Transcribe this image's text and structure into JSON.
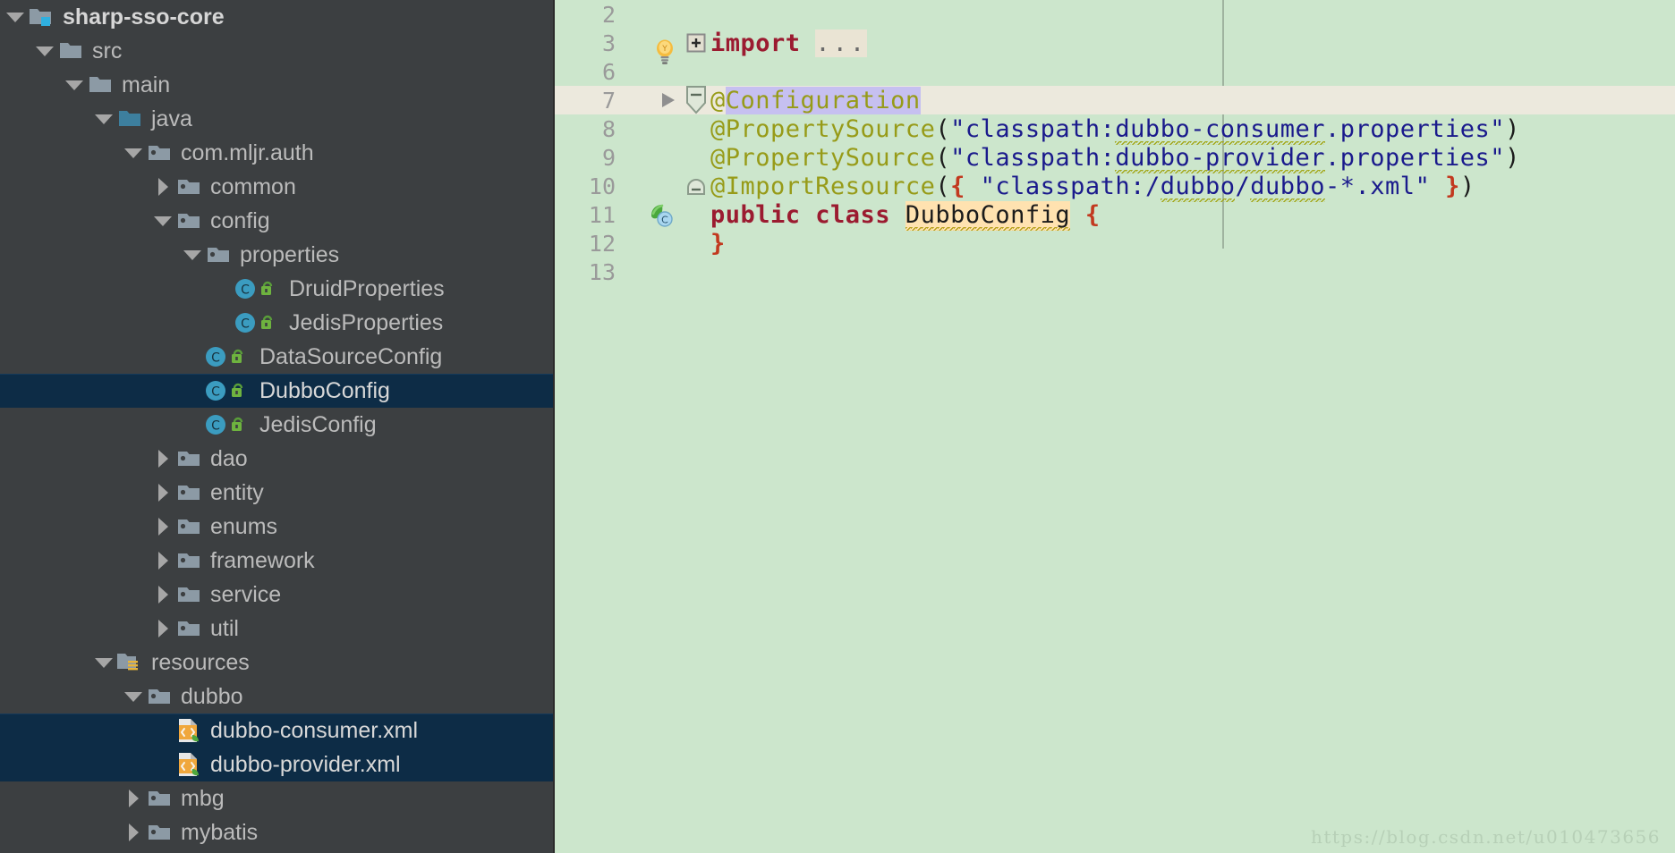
{
  "app": {
    "theme_sidebar_bg": "#3c3f41",
    "theme_editor_bg": "#cce6cc",
    "selection_bg": "#0d2c46",
    "caret_row_bg": "#ece9dd",
    "watermark": "https://blog.csdn.net/u010473656"
  },
  "project_tree": {
    "items": [
      {
        "label": "sharp-sso-core",
        "depth": 0,
        "twisty": "down",
        "icon": "module-folder-icon",
        "selected": false,
        "bold": true
      },
      {
        "label": "src",
        "depth": 1,
        "twisty": "down",
        "icon": "folder-icon",
        "selected": false,
        "bold": false
      },
      {
        "label": "main",
        "depth": 2,
        "twisty": "down",
        "icon": "folder-icon",
        "selected": false,
        "bold": false
      },
      {
        "label": "java",
        "depth": 3,
        "twisty": "down",
        "icon": "source-root-icon",
        "selected": false,
        "bold": false
      },
      {
        "label": "com.mljr.auth",
        "depth": 4,
        "twisty": "down",
        "icon": "package-icon",
        "selected": false,
        "bold": false
      },
      {
        "label": "common",
        "depth": 5,
        "twisty": "right",
        "icon": "package-icon",
        "selected": false,
        "bold": false
      },
      {
        "label": "config",
        "depth": 5,
        "twisty": "down",
        "icon": "package-icon",
        "selected": false,
        "bold": false
      },
      {
        "label": "properties",
        "depth": 6,
        "twisty": "down",
        "icon": "package-icon",
        "selected": false,
        "bold": false
      },
      {
        "label": "DruidProperties",
        "depth": 7,
        "twisty": "none",
        "icon": "java-class-icon",
        "selected": false,
        "bold": false
      },
      {
        "label": "JedisProperties",
        "depth": 7,
        "twisty": "none",
        "icon": "java-class-icon",
        "selected": false,
        "bold": false
      },
      {
        "label": "DataSourceConfig",
        "depth": 6,
        "twisty": "none",
        "icon": "java-class-icon",
        "selected": false,
        "bold": false
      },
      {
        "label": "DubboConfig",
        "depth": 6,
        "twisty": "none",
        "icon": "java-class-icon",
        "selected": true,
        "bold": false
      },
      {
        "label": "JedisConfig",
        "depth": 6,
        "twisty": "none",
        "icon": "java-class-icon",
        "selected": false,
        "bold": false
      },
      {
        "label": "dao",
        "depth": 5,
        "twisty": "right",
        "icon": "package-icon",
        "selected": false,
        "bold": false
      },
      {
        "label": "entity",
        "depth": 5,
        "twisty": "right",
        "icon": "package-icon",
        "selected": false,
        "bold": false
      },
      {
        "label": "enums",
        "depth": 5,
        "twisty": "right",
        "icon": "package-icon",
        "selected": false,
        "bold": false
      },
      {
        "label": "framework",
        "depth": 5,
        "twisty": "right",
        "icon": "package-icon",
        "selected": false,
        "bold": false
      },
      {
        "label": "service",
        "depth": 5,
        "twisty": "right",
        "icon": "package-icon",
        "selected": false,
        "bold": false
      },
      {
        "label": "util",
        "depth": 5,
        "twisty": "right",
        "icon": "package-icon",
        "selected": false,
        "bold": false
      },
      {
        "label": "resources",
        "depth": 3,
        "twisty": "down",
        "icon": "resources-root-icon",
        "selected": false,
        "bold": false
      },
      {
        "label": "dubbo",
        "depth": 4,
        "twisty": "down",
        "icon": "package-icon",
        "selected": false,
        "bold": false
      },
      {
        "label": "dubbo-consumer.xml",
        "depth": 5,
        "twisty": "none",
        "icon": "spring-xml-icon",
        "selected": true,
        "bold": false
      },
      {
        "label": "dubbo-provider.xml",
        "depth": 5,
        "twisty": "none",
        "icon": "spring-xml-icon",
        "selected": true,
        "bold": false
      },
      {
        "label": "mbg",
        "depth": 4,
        "twisty": "right",
        "icon": "package-icon",
        "selected": false,
        "bold": false
      },
      {
        "label": "mybatis",
        "depth": 4,
        "twisty": "right",
        "icon": "package-icon",
        "selected": false,
        "bold": false
      }
    ]
  },
  "editor": {
    "file": "DubboConfig",
    "lines": [
      {
        "num": "2",
        "caret": false,
        "fold": "",
        "gutter": "",
        "tokens": []
      },
      {
        "num": "3",
        "caret": false,
        "fold": "plus",
        "gutter": "",
        "tokens": [
          {
            "t": "import",
            "c": "tk-kw"
          },
          {
            "t": " ",
            "c": "tk-punct"
          },
          {
            "t": "...",
            "c": "tk-fold"
          }
        ]
      },
      {
        "num": "6",
        "caret": false,
        "fold": "",
        "gutter": "lightbulb-icon",
        "tokens": []
      },
      {
        "num": "7",
        "caret": true,
        "fold": "minus-shield",
        "gutter": "fold-arrow-icon",
        "tokens": [
          {
            "t": "@",
            "c": "tk-anno"
          },
          {
            "t": "Configuration",
            "c": "tk-sel"
          }
        ]
      },
      {
        "num": "8",
        "caret": false,
        "fold": "",
        "gutter": "",
        "tokens": [
          {
            "t": "@PropertySource",
            "c": "tk-anno"
          },
          {
            "t": "(",
            "c": "tk-punct"
          },
          {
            "t": "\"classpath:",
            "c": "tk-str"
          },
          {
            "t": "dubbo-consumer",
            "c": "tk-str squig"
          },
          {
            "t": ".properties\"",
            "c": "tk-str"
          },
          {
            "t": ")",
            "c": "tk-punct"
          }
        ]
      },
      {
        "num": "9",
        "caret": false,
        "fold": "",
        "gutter": "",
        "tokens": [
          {
            "t": "@PropertySource",
            "c": "tk-anno"
          },
          {
            "t": "(",
            "c": "tk-punct"
          },
          {
            "t": "\"classpath:",
            "c": "tk-str"
          },
          {
            "t": "dubbo-provider",
            "c": "tk-str squig"
          },
          {
            "t": ".properties\"",
            "c": "tk-str"
          },
          {
            "t": ")",
            "c": "tk-punct"
          }
        ]
      },
      {
        "num": "10",
        "caret": false,
        "fold": "minus-shield-small",
        "gutter": "",
        "tokens": [
          {
            "t": "@ImportResource",
            "c": "tk-anno"
          },
          {
            "t": "(",
            "c": "tk-punct"
          },
          {
            "t": "{",
            "c": "tk-brace"
          },
          {
            "t": " \"classpath:/",
            "c": "tk-str"
          },
          {
            "t": "dubbo",
            "c": "tk-str squig"
          },
          {
            "t": "/",
            "c": "tk-str"
          },
          {
            "t": "dubbo",
            "c": "tk-str squig"
          },
          {
            "t": "-*.xml\"",
            "c": "tk-str"
          },
          {
            "t": " ",
            "c": "tk-punct"
          },
          {
            "t": "}",
            "c": "tk-brace"
          },
          {
            "t": ")",
            "c": "tk-punct"
          }
        ]
      },
      {
        "num": "11",
        "caret": false,
        "fold": "",
        "gutter": "spring-bean-icon",
        "tokens": [
          {
            "t": "public class ",
            "c": "tk-kw"
          },
          {
            "t": "DubboConfig",
            "c": "tk-cls ul-cls"
          },
          {
            "t": " ",
            "c": "tk-punct"
          },
          {
            "t": "{",
            "c": "tk-brace"
          }
        ]
      },
      {
        "num": "12",
        "caret": false,
        "fold": "",
        "gutter": "",
        "tokens": [
          {
            "t": "}",
            "c": "tk-brace"
          }
        ]
      },
      {
        "num": "13",
        "caret": false,
        "fold": "",
        "gutter": "",
        "tokens": []
      }
    ]
  }
}
